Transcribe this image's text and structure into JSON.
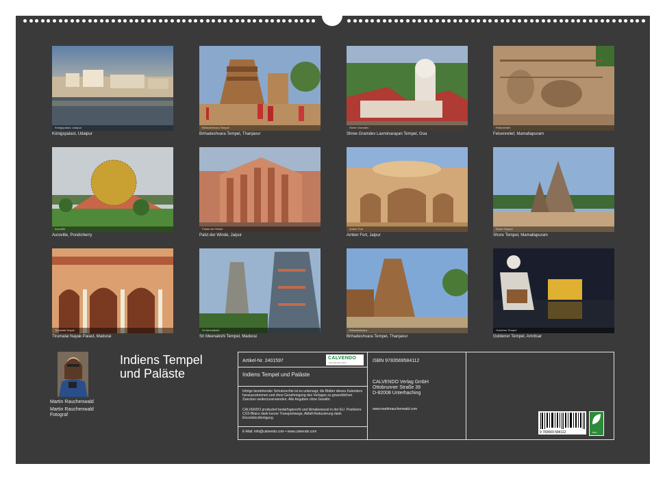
{
  "colors": {
    "page_background": "#3a3a3a",
    "binding_holes": "#ffffff",
    "text": "#ececec"
  },
  "tiles": [
    {
      "caption": "Königspalast, Udaipur",
      "image_label": "Königspalast, Udaipur",
      "theme": "#7d8ea8"
    },
    {
      "caption": "Brihadeshvara Tempel, Thanjavur",
      "image_label": "Brihadeshvara Tempel",
      "theme": "#8aa8cc"
    },
    {
      "caption": "Shree Gramdev Laxminarayan Tempel, Goa",
      "image_label": "Shree Gramdev",
      "theme": "#8fa6c4"
    },
    {
      "caption": "Felsenrelief, Mamallapuram",
      "image_label": "Felsenrelief",
      "theme": "#b49270"
    },
    {
      "caption": "Auroville, Pondicherry",
      "image_label": "Auroville",
      "theme": "#c8cdd2"
    },
    {
      "caption": "Palst der Winde, Jaipur",
      "image_label": "Palast der Winde",
      "theme": "#a3b6cc"
    },
    {
      "caption": "Amber Fort, Jaipur",
      "image_label": "Amber Fort",
      "theme": "#c8a070"
    },
    {
      "caption": "Shore Tempel, Mamallapuram",
      "image_label": "Shore Tempel",
      "theme": "#8fb0d4"
    },
    {
      "caption": "Tirumalai Nayak Palast, Madurai",
      "image_label": "Tirumalai Nayak",
      "theme": "#d6a070"
    },
    {
      "caption": "Sri Meenakshi Tempel, Madurai",
      "image_label": "Sri Meenakshi",
      "theme": "#9ab4cf"
    },
    {
      "caption": "Brihadeshvara Tempel, Thanjavur",
      "image_label": "Brihadeshvara",
      "theme": "#7fa8d6"
    },
    {
      "caption": "Goldener Tempel, Amritsar",
      "image_label": "Goldener Tempel",
      "theme": "#1a1e2c"
    }
  ],
  "title_line1": "Indiens Tempel",
  "title_line2": "und Paläste",
  "author": {
    "name": "Martin Rauchenwald",
    "block_line1": "Martin Rauchenwald",
    "block_line2": "Fotograf"
  },
  "info": {
    "article": "Artikel-Nr. 2401597",
    "isbn": "ISBN 9783569584112",
    "calendar_title": "Indiens Tempel und Paläste",
    "logo_text": "CALVENDO",
    "logo_sub": "Die Kalendermarke",
    "publisher_line1": "CALVENDO Verlag GmbH",
    "publisher_line2": "Ottobrunner Straße 39",
    "publisher_line3": "D-82008 Unterhaching",
    "copyright_text": "Infolge bestehender Schutzrechte ist es untersagt, die Blätter dieses Kalenders herauszutrennen und ohne Genehmigung des Verlages zu gewerblichen Zwecken weiterzuverwenden. Alle Angaben ohne Gewähr.",
    "eco_text": "CALVENDO produziert bedarfsgerecht und klimabewusst in der EU. Positivere CO2-Bilanz dank kurzer Transportwege, Abfall-Reduzierung dank Einzelstückfertigung",
    "website": "www.martinrauchenwald.com",
    "contact": "E-Mail: info@calvendo.com • www.calvendo.com",
    "barcode_number": "9 783569 584112",
    "eco_label": "eco"
  }
}
